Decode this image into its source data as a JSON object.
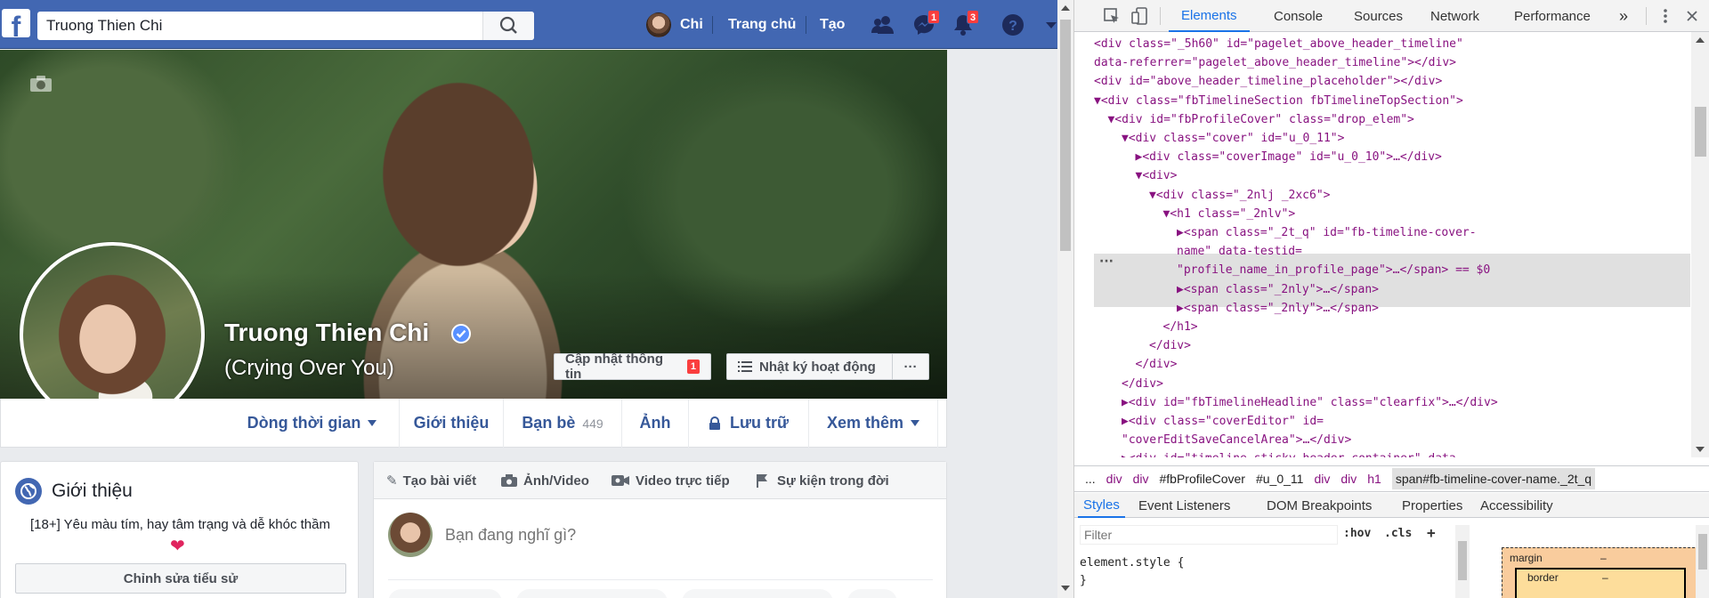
{
  "facebook": {
    "logo": "f",
    "search": {
      "value": "Truong Thien Chi",
      "placeholder": ""
    },
    "nav": {
      "user": "Chi",
      "home": "Trang chủ",
      "create": "Tạo",
      "messages_badge": "1",
      "notifications_badge": "3"
    },
    "profile": {
      "name": "Truong Thien Chi",
      "alternate_name": "(Crying Over You)",
      "update_info_button": "Cập nhật thông tin",
      "update_info_badge": "1",
      "activity_log_button": "Nhật ký hoạt động",
      "more_button": "···"
    },
    "timeline_tabs": [
      {
        "label": "Dòng thời gian"
      },
      {
        "label": "Giới thiệu"
      },
      {
        "label": "Bạn bè",
        "count": "449"
      },
      {
        "label": "Ảnh"
      },
      {
        "label": "Lưu trữ"
      },
      {
        "label": "Xem thêm"
      }
    ],
    "intro": {
      "title": "Giới thiệu",
      "bio": "[18+] Yêu màu tím, hay tâm trạng và dễ khóc thầm",
      "heart": "❤",
      "edit_button": "Chỉnh sửa tiểu sử"
    },
    "composer": {
      "tabs": [
        "Tạo bài viết",
        "Ảnh/Video",
        "Video trực tiếp",
        "Sự kiện trong đời"
      ],
      "placeholder": "Bạn đang nghĩ gì?"
    },
    "colors": {
      "brand": "#4267b2",
      "link": "#365899",
      "badge": "#fa3e3e"
    }
  },
  "devtools": {
    "tabs": [
      "Elements",
      "Console",
      "Sources",
      "Network",
      "Performance"
    ],
    "more_tabs": "»",
    "dom_lines": [
      {
        "indent": 0,
        "text": "<div class=\"_5h60\" id=\"pagelet_above_header_timeline\""
      },
      {
        "indent": 0,
        "text": "data-referrer=\"pagelet_above_header_timeline\"></div>"
      },
      {
        "indent": 0,
        "text": "<div id=\"above_header_timeline_placeholder\"></div>"
      },
      {
        "indent": 0,
        "text": "▼<div class=\"fbTimelineSection fbTimelineTopSection\">"
      },
      {
        "indent": 1,
        "text": "▼<div id=\"fbProfileCover\" class=\"drop_elem\">"
      },
      {
        "indent": 2,
        "text": "▼<div class=\"cover\" id=\"u_0_11\">"
      },
      {
        "indent": 3,
        "text": "▶<div class=\"coverImage\" id=\"u_0_10\">…</div>"
      },
      {
        "indent": 3,
        "text": "▼<div>"
      },
      {
        "indent": 4,
        "text": "▼<div class=\"_2nlj _2xc6\">"
      },
      {
        "indent": 5,
        "text": "▼<h1 class=\"_2nlv\">"
      },
      {
        "indent": 6,
        "text": "▶<span class=\"_2t_q\" id=\"fb-timeline-cover-"
      },
      {
        "indent": 6,
        "text": "name\" data-testid="
      },
      {
        "indent": 6,
        "text": "\"profile_name_in_profile_page\">…</span> == $0"
      },
      {
        "indent": 6,
        "text": "▶<span class=\"_2nly\">…</span>"
      },
      {
        "indent": 6,
        "text": "▶<span class=\"_2nly\">…</span>"
      },
      {
        "indent": 5,
        "text": "</h1>"
      },
      {
        "indent": 4,
        "text": "</div>"
      },
      {
        "indent": 3,
        "text": "</div>"
      },
      {
        "indent": 2,
        "text": "</div>"
      },
      {
        "indent": 2,
        "text": "▶<div id=\"fbTimelineHeadline\" class=\"clearfix\">…</div>"
      },
      {
        "indent": 2,
        "text": "▶<div class=\"coverEditor\" id="
      },
      {
        "indent": 2,
        "text": "\"coverEditSaveCancelArea\">…</div>"
      },
      {
        "indent": 2,
        "text": "▶<div id=\"timeline_sticky_header_container\" data-"
      }
    ],
    "selected_marker": "···",
    "breadcrumb": [
      "...",
      "div",
      "div",
      "#fbProfileCover",
      "#u_0_11",
      "div",
      "div",
      "h1",
      "span#fb-timeline-cover-name._2t_q"
    ],
    "subtabs": [
      "Styles",
      "Event Listeners",
      "DOM Breakpoints",
      "Properties",
      "Accessibility"
    ],
    "styles": {
      "filter_placeholder": "Filter",
      "hov": ":hov",
      "cls": ".cls",
      "add": "+",
      "element_style_open": "element.style {",
      "element_style_close": "}"
    },
    "box_model": {
      "margin_label": "margin",
      "margin_value": "–",
      "border_label": "border",
      "border_value": "–"
    }
  }
}
